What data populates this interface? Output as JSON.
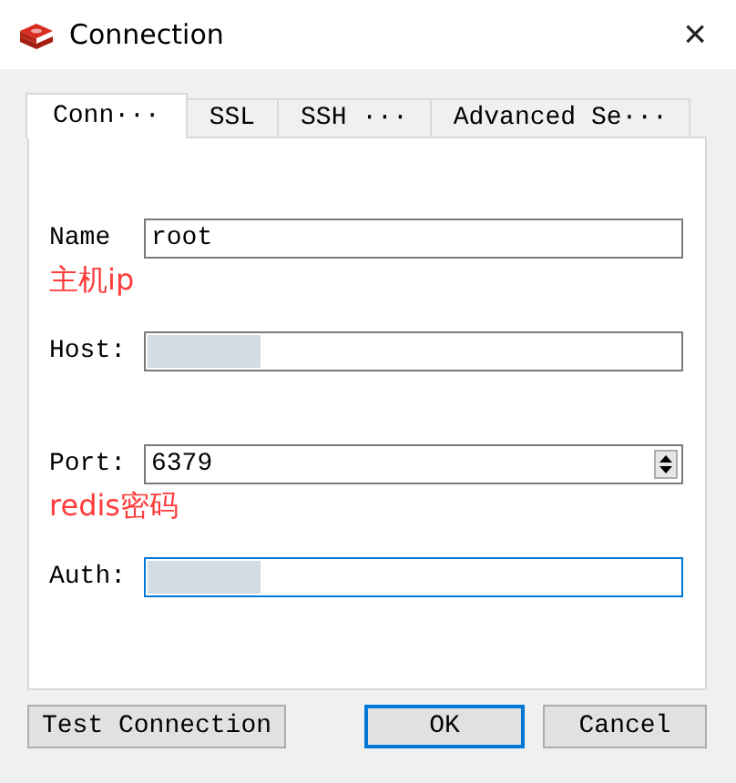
{
  "window": {
    "title": "Connection",
    "close": "×"
  },
  "tabs": [
    {
      "label": "Conn···",
      "selected": true
    },
    {
      "label": "SSL",
      "selected": false
    },
    {
      "label": "SSH ···",
      "selected": false
    },
    {
      "label": "Advanced Se···",
      "selected": false
    }
  ],
  "rows": [
    {
      "kind": "text",
      "label": "Name",
      "value": "root",
      "redacted": false,
      "focused": false,
      "note": "主机ip"
    },
    {
      "kind": "text",
      "label": "Host:",
      "value": "",
      "redacted": true,
      "focused": false
    },
    {
      "kind": "spin",
      "label": "Port:",
      "value": "6379",
      "redacted": false,
      "focused": false,
      "note": "redis密码"
    },
    {
      "kind": "text",
      "label": "Auth:",
      "value": "",
      "redacted": true,
      "focused": true
    }
  ],
  "buttons": [
    {
      "label": "Test Connection",
      "default": false
    },
    {
      "label": "OK",
      "default": true
    },
    {
      "label": "Cancel",
      "default": false
    }
  ]
}
